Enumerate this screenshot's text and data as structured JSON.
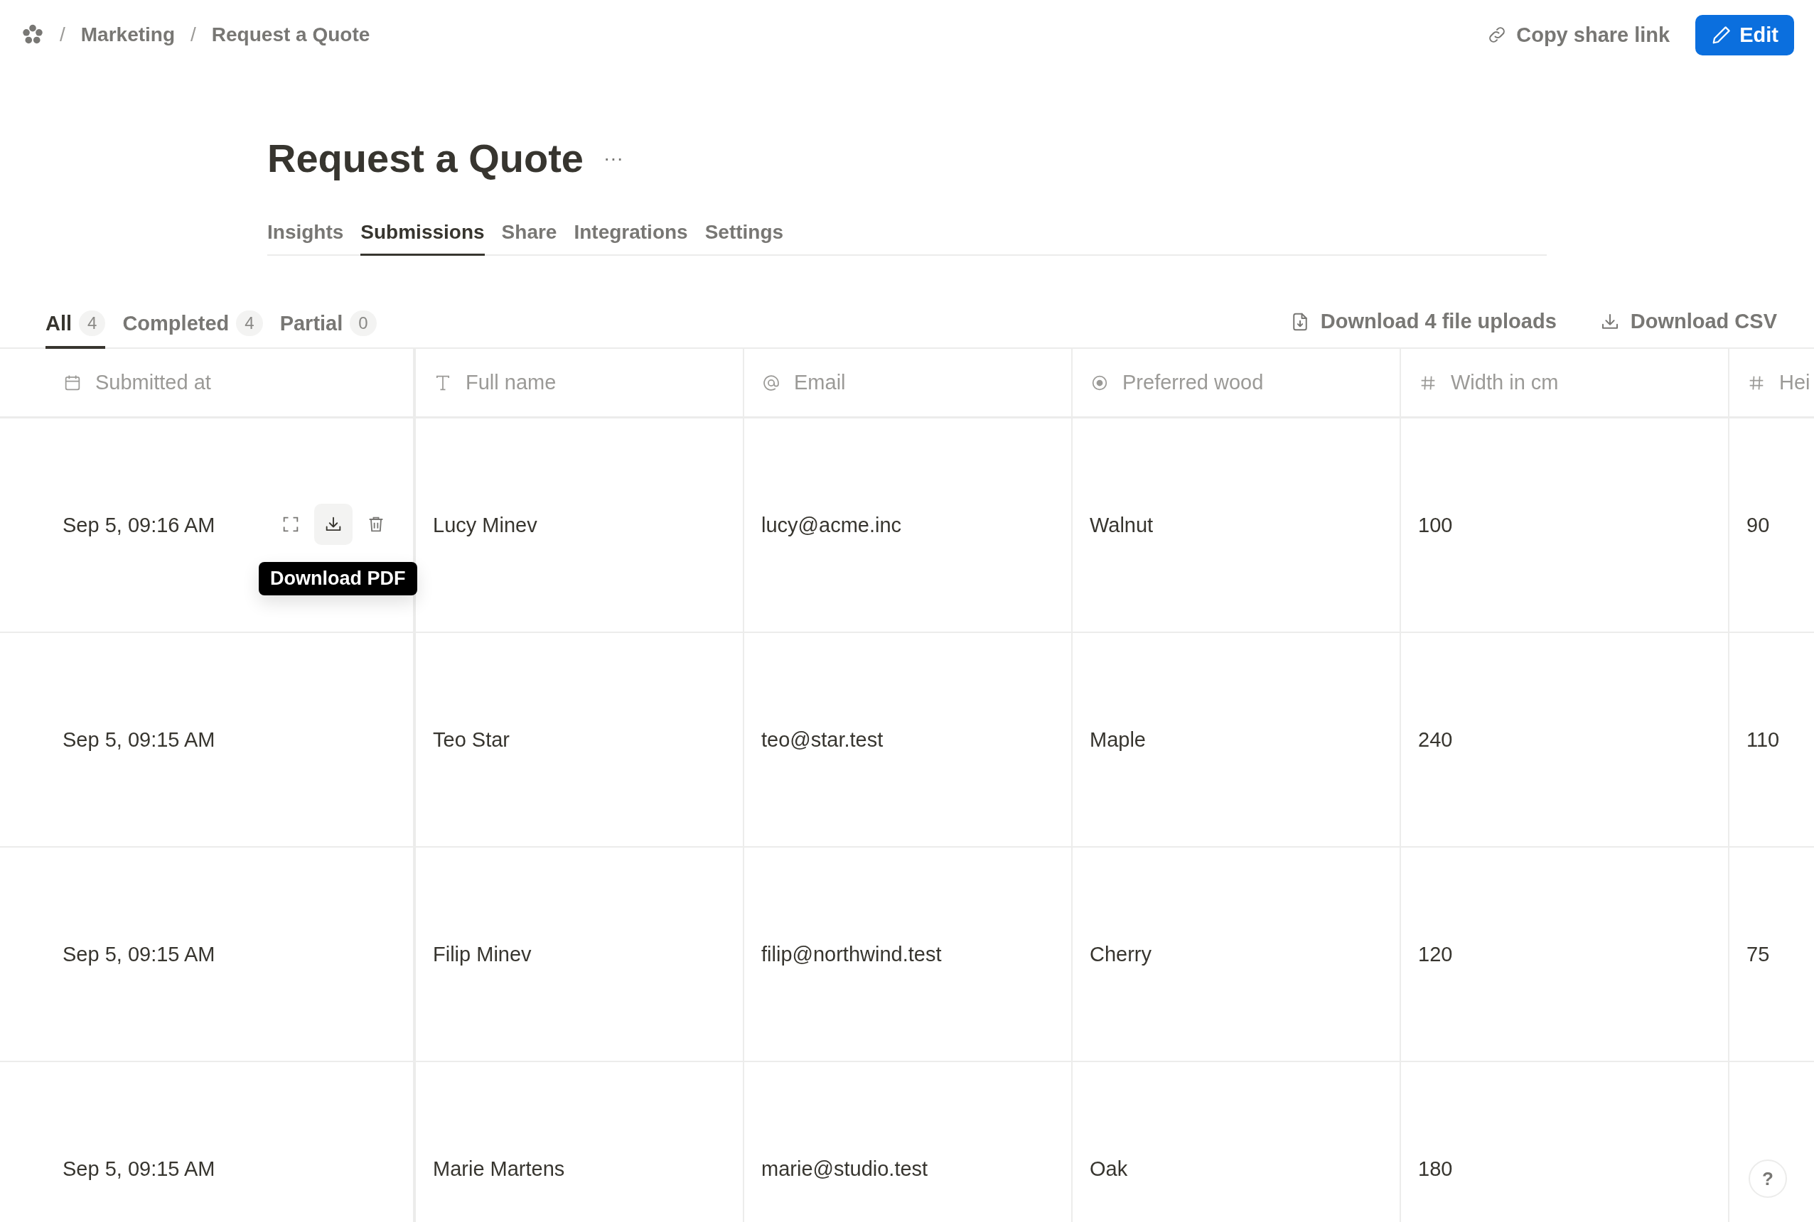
{
  "breadcrumb": [
    {
      "separator": "/",
      "label": "Marketing"
    },
    {
      "separator": "/",
      "label": "Request a Quote"
    }
  ],
  "header_actions": {
    "copy_link": "Copy share link",
    "edit": "Edit"
  },
  "title": "Request a Quote",
  "title_menu": "···",
  "tabs": [
    {
      "label": "Insights",
      "selected": false
    },
    {
      "label": "Submissions",
      "selected": true
    },
    {
      "label": "Share",
      "selected": false
    },
    {
      "label": "Integrations",
      "selected": false
    },
    {
      "label": "Settings",
      "selected": false
    }
  ],
  "filters": [
    {
      "label": "All",
      "count": "4",
      "selected": true
    },
    {
      "label": "Completed",
      "count": "4",
      "selected": false
    },
    {
      "label": "Partial",
      "count": "0",
      "selected": false
    }
  ],
  "downloads": [
    {
      "kind": "files",
      "label": "Download 4 file uploads"
    },
    {
      "kind": "csv",
      "label": "Download CSV"
    }
  ],
  "table": {
    "columns": [
      {
        "kind": "date",
        "label": "Submitted at"
      },
      {
        "kind": "text",
        "label": "Full name"
      },
      {
        "kind": "email",
        "label": "Email"
      },
      {
        "kind": "choice",
        "label": "Preferred wood"
      },
      {
        "kind": "number",
        "label": "Width in cm"
      },
      {
        "kind": "number",
        "label": "Hei"
      }
    ],
    "tooltip": "Download PDF",
    "rows": [
      {
        "hovered": true,
        "cells": [
          "Sep 5, 09:16 AM",
          "Lucy Minev",
          "lucy@acme.inc",
          "Walnut",
          "100",
          "90"
        ]
      },
      {
        "hovered": false,
        "cells": [
          "Sep 5, 09:15 AM",
          "Teo Star",
          "teo@star.test",
          "Maple",
          "240",
          "110"
        ]
      },
      {
        "hovered": false,
        "cells": [
          "Sep 5, 09:15 AM",
          "Filip Minev",
          "filip@northwind.test",
          "Cherry",
          "120",
          "75"
        ]
      },
      {
        "hovered": false,
        "cells": [
          "Sep 5, 09:15 AM",
          "Marie Martens",
          "marie@studio.test",
          "Oak",
          "180"
        ]
      }
    ]
  },
  "help": "?"
}
